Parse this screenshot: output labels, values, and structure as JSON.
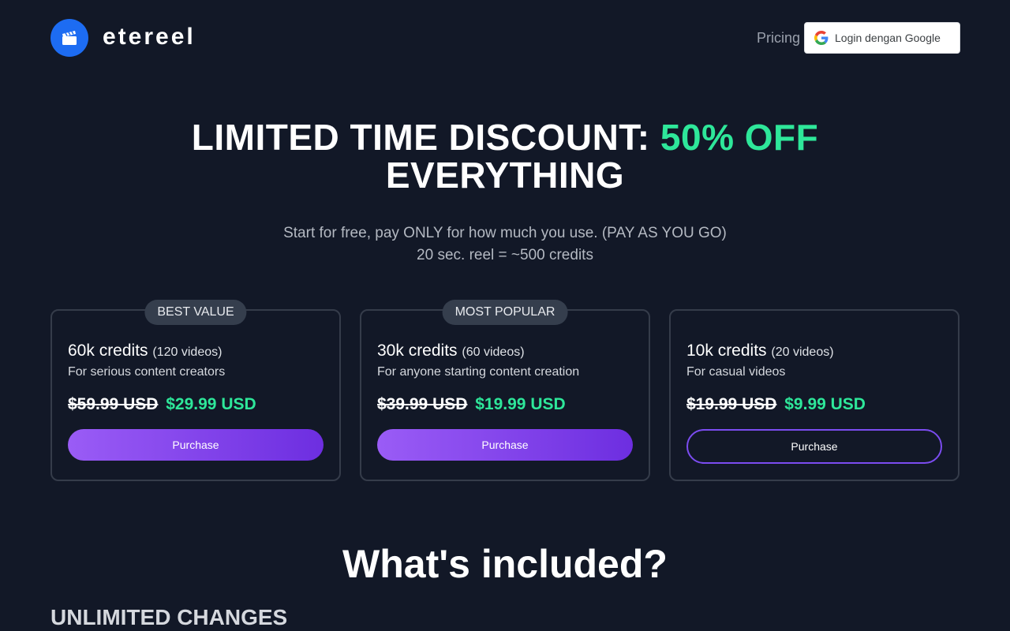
{
  "header": {
    "brand": "etereel",
    "logo_icon": "clapperboard-icon",
    "nav_pricing": "Pricing",
    "login_label": "Login dengan Google",
    "login_icon": "google-g-icon"
  },
  "hero": {
    "title_part1": "LIMITED TIME DISCOUNT: ",
    "title_accent": "50% OFF",
    "title_part2": "EVERYTHING",
    "subtitle_line1": "Start for free, pay ONLY for how much you use. (PAY AS YOU GO)",
    "subtitle_line2": "20 sec. reel = ~500 credits"
  },
  "plans": [
    {
      "badge": "BEST VALUE",
      "credits": "60k credits",
      "videos": "(120 videos)",
      "description": "For serious content creators",
      "old_price": "$59.99 USD",
      "new_price": "$29.99 USD",
      "button": "Purchase"
    },
    {
      "badge": "MOST POPULAR",
      "credits": "30k credits",
      "videos": "(60 videos)",
      "description": "For anyone starting content creation",
      "old_price": "$39.99 USD",
      "new_price": "$19.99 USD",
      "button": "Purchase"
    },
    {
      "credits": "10k credits",
      "videos": "(20 videos)",
      "description": "For casual videos",
      "old_price": "$19.99 USD",
      "new_price": "$9.99 USD",
      "button": "Purchase"
    }
  ],
  "included": {
    "heading": "What's included?",
    "first_item": "UNLIMITED CHANGES"
  },
  "colors": {
    "background": "#121827",
    "accent_green": "#2ee79a",
    "accent_purple": "#7b4cf0",
    "logo_blue": "#1d6cf2"
  }
}
